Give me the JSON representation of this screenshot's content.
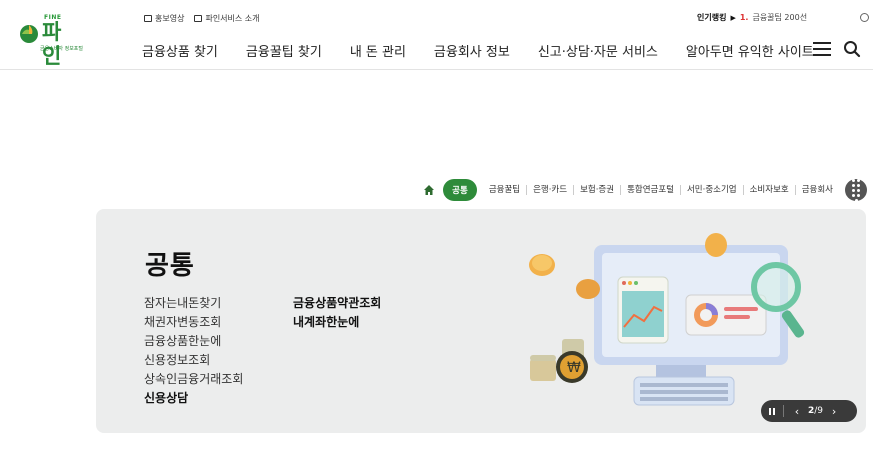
{
  "logo": {
    "fine": "FINE",
    "name": "파 인",
    "subtitle": "금융소비자 정보포털"
  },
  "utility": {
    "promo_video": "홍보영상",
    "service_intro": "파인서비스 소개"
  },
  "ranking": {
    "label": "인기랭킹",
    "number": "1.",
    "text": "금융꿀팁 200선"
  },
  "gnb": [
    "금융상품 찾기",
    "금융꿀팁 찾기",
    "내 돈 관리",
    "금융회사 정보",
    "신고·상담·자문 서비스",
    "알아두면 유익한 사이트"
  ],
  "categories": {
    "active": "공통",
    "items": [
      "금융꿀팁",
      "은행·카드",
      "보험·증권",
      "통합연금포털",
      "서민·중소기업",
      "소비자보호",
      "금융회사"
    ]
  },
  "panel": {
    "title": "공통",
    "col1": [
      "잠자는내돈찾기",
      "채권자변동조회",
      "금융상품한눈에",
      "신용정보조회",
      "상속인금융거래조회",
      "신용상담"
    ],
    "col2": [
      "금융상품약관조회",
      "내계좌한눈에"
    ]
  },
  "pager": {
    "current": "2",
    "total": "/9"
  },
  "colors": {
    "brand_green": "#2e8b3a",
    "panel_bg": "#eceded",
    "rank_red": "#dd3333"
  }
}
